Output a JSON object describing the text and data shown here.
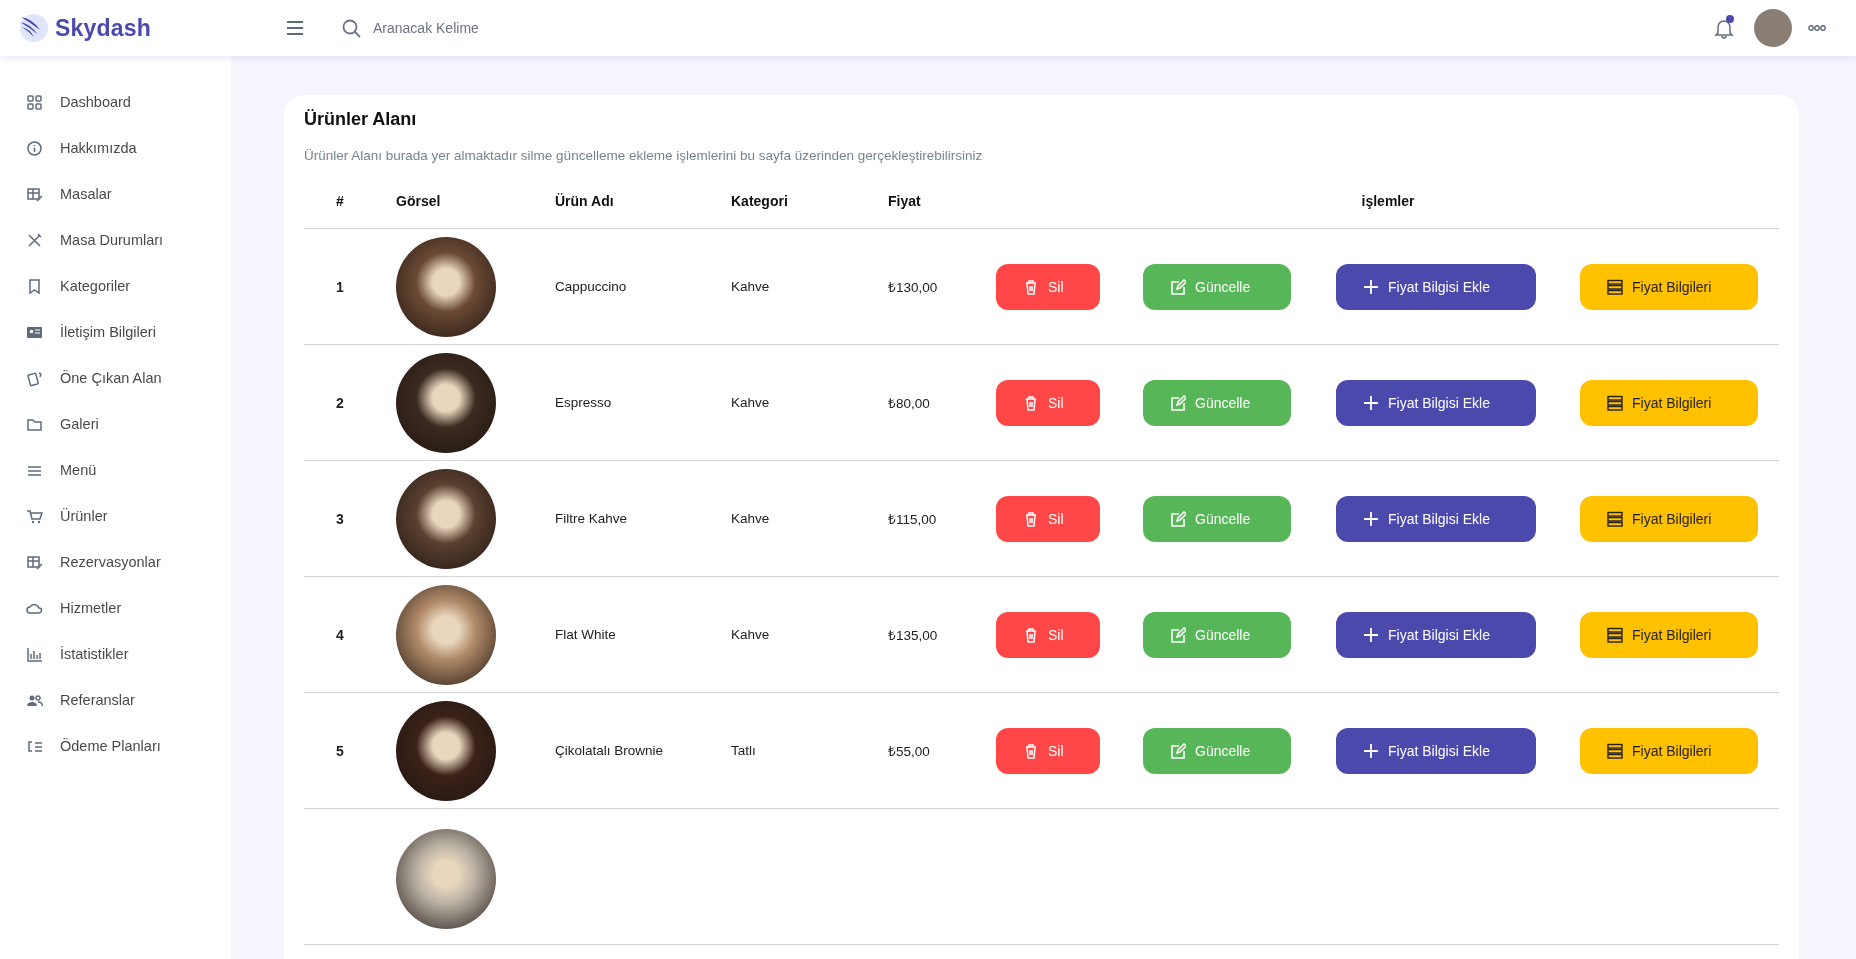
{
  "header": {
    "logo": "Skydash",
    "search": {
      "placeholder": "Aranacak Kelime"
    },
    "has_notification": true
  },
  "sidebar": {
    "items": [
      {
        "label": "Dashboard",
        "selected": false
      },
      {
        "label": "Hakkımızda",
        "selected": false
      },
      {
        "label": "Masalar",
        "selected": false
      },
      {
        "label": "Masa Durumları",
        "selected": false
      },
      {
        "label": "Kategoriler",
        "selected": false
      },
      {
        "label": "İletişim Bilgileri",
        "selected": false
      },
      {
        "label": "Öne Çıkan Alan",
        "selected": false
      },
      {
        "label": "Galeri",
        "selected": false
      },
      {
        "label": "Menü",
        "selected": false
      },
      {
        "label": "Ürünler",
        "selected": false
      },
      {
        "label": "Rezervasyonlar",
        "selected": false
      },
      {
        "label": "Hizmetler",
        "selected": false
      },
      {
        "label": "İstatistikler",
        "selected": false
      },
      {
        "label": "Referanslar",
        "selected": false
      },
      {
        "label": "Ödeme Planları",
        "selected": false
      }
    ]
  },
  "card": {
    "title": "Ürünler Alanı",
    "description": "Ürünler Alanı burada yer almaktadır silme güncelleme ekleme işlemlerini bu sayfa üzerinden gerçekleştirebilirsiniz"
  },
  "table": {
    "columns": [
      "#",
      "Görsel",
      "Ürün Adı",
      "Kategori",
      "Fiyat",
      "işlemler"
    ],
    "rows": [
      {
        "kind": "full",
        "number": "1",
        "name": "Cappuccino",
        "category": "Kahve",
        "price": "₺130,00",
        "actions": [
          "Sil",
          "Güncelle",
          "Fiyat Bilgisi Ekle",
          "Fiyat Bilgileri"
        ]
      },
      {
        "kind": "full",
        "number": "2",
        "name": "Espresso",
        "category": "Kahve",
        "price": "₺80,00",
        "actions": [
          "Sil",
          "Güncelle",
          "Fiyat Bilgisi Ekle",
          "Fiyat Bilgileri"
        ]
      },
      {
        "kind": "full",
        "number": "3",
        "name": "Filtre Kahve",
        "category": "Kahve",
        "price": "₺115,00",
        "actions": [
          "Sil",
          "Güncelle",
          "Fiyat Bilgisi Ekle",
          "Fiyat Bilgileri"
        ]
      },
      {
        "kind": "full",
        "number": "4",
        "name": "Flat White",
        "category": "Kahve",
        "price": "₺135,00",
        "actions": [
          "Sil",
          "Güncelle",
          "Fiyat Bilgisi Ekle",
          "Fiyat Bilgileri"
        ]
      },
      {
        "kind": "full",
        "number": "5",
        "name": "Çikolatalı Brownie",
        "category": "Tatlı",
        "price": "₺55,00",
        "actions": [
          "Sil",
          "Güncelle",
          "Fiyat Bilgisi Ekle",
          "Fiyat Bilgileri"
        ]
      },
      {
        "kind": "partial"
      }
    ]
  }
}
